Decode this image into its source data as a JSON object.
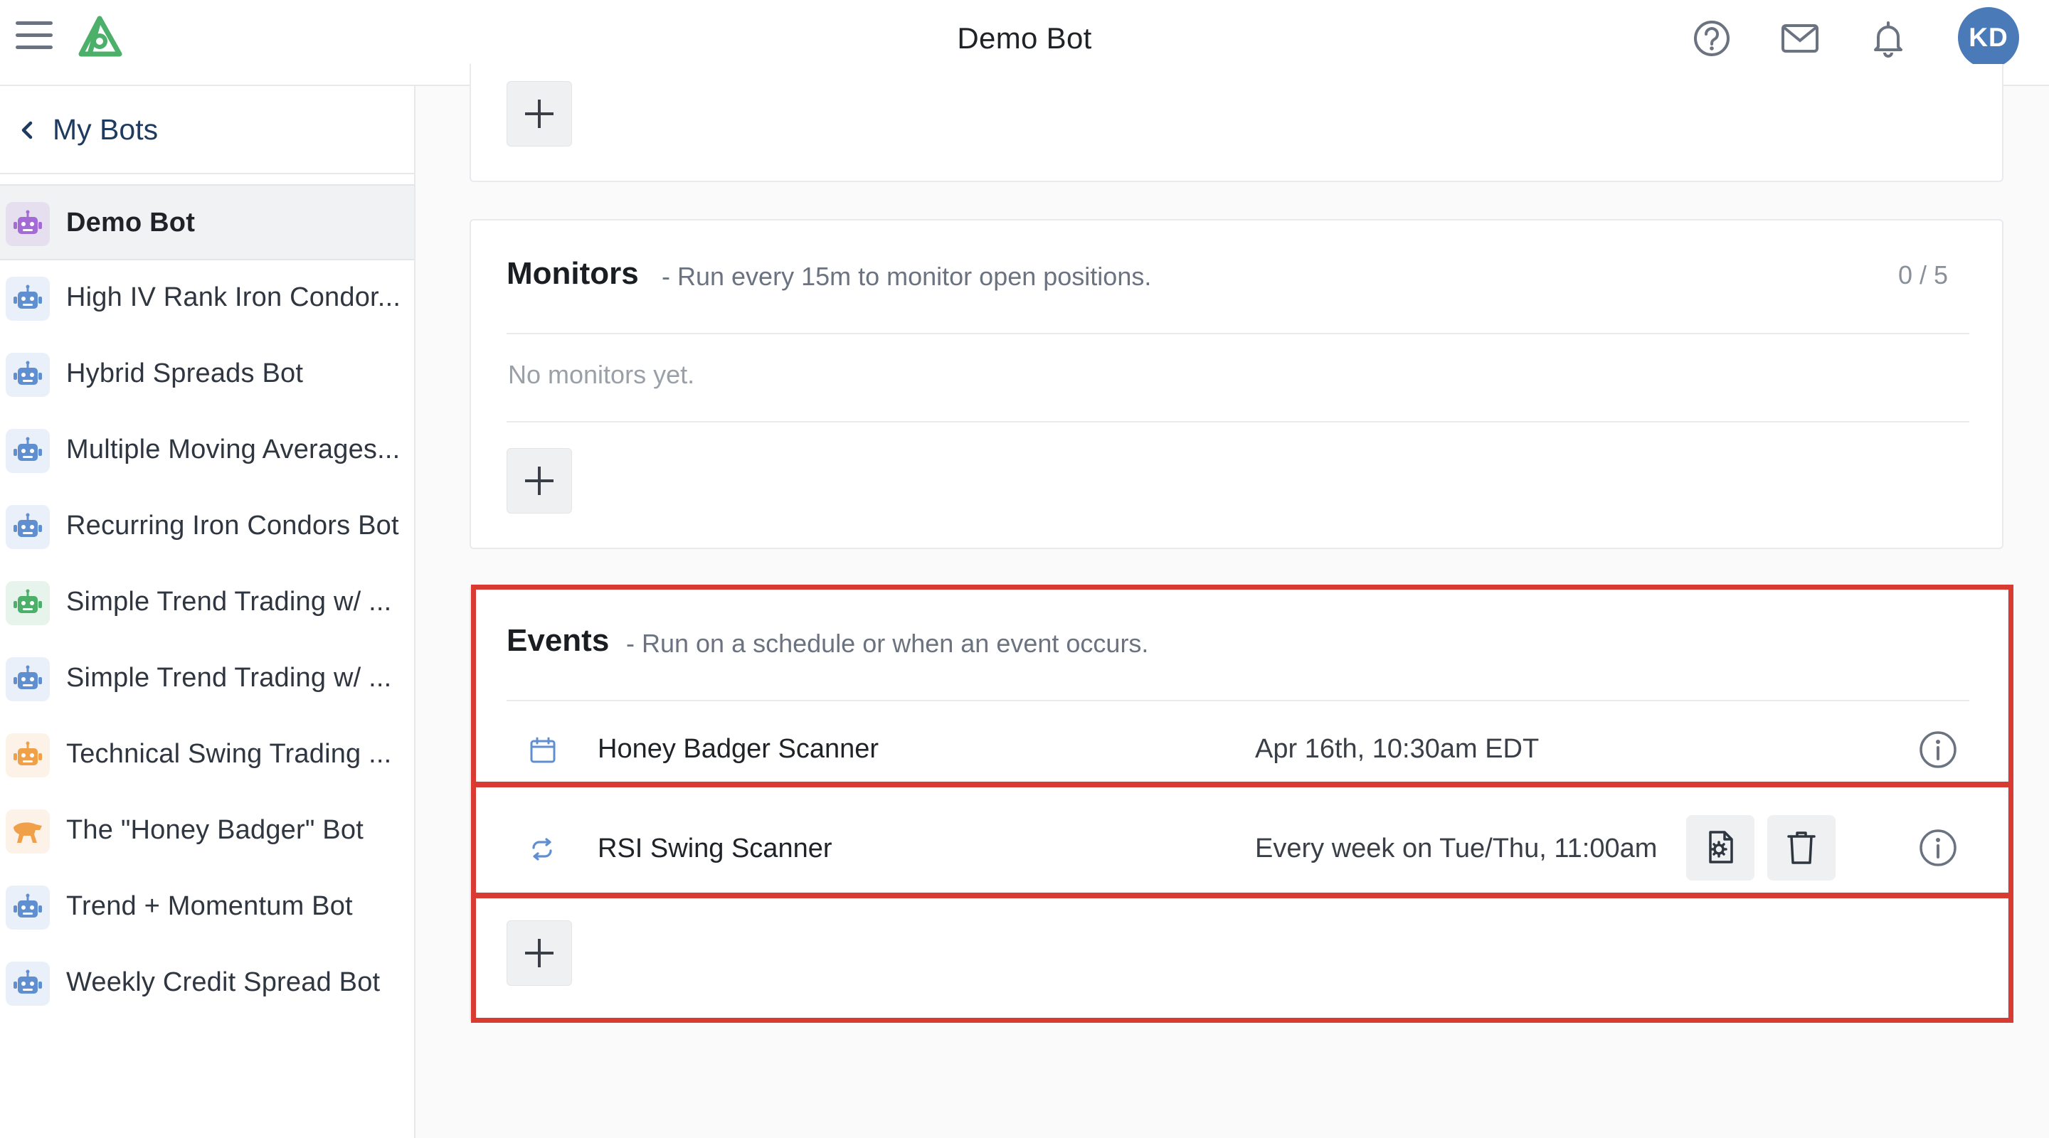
{
  "header": {
    "title": "Demo Bot",
    "avatar_initials": "KD",
    "accent_color": "#4a7ab8"
  },
  "sidebar": {
    "back_label": "My Bots",
    "items": [
      {
        "label": "Demo Bot",
        "icon": "robot-icon",
        "color": "#a46bd6",
        "active": true
      },
      {
        "label": "High IV Rank Iron Condor...",
        "icon": "robot-icon",
        "color": "#5f8fd0"
      },
      {
        "label": "Hybrid Spreads Bot",
        "icon": "robot-icon",
        "color": "#5f8fd0"
      },
      {
        "label": "Multiple Moving Averages...",
        "icon": "robot-icon",
        "color": "#5f8fd0"
      },
      {
        "label": "Recurring Iron Condors Bot",
        "icon": "robot-icon",
        "color": "#5f8fd0"
      },
      {
        "label": "Simple Trend Trading w/ ...",
        "icon": "robot-icon",
        "color": "#4caf6a"
      },
      {
        "label": "Simple Trend Trading w/ ...",
        "icon": "robot-icon",
        "color": "#5f8fd0"
      },
      {
        "label": "Technical Swing Trading ...",
        "icon": "robot-icon",
        "color": "#f0a048"
      },
      {
        "label": "The \"Honey Badger\" Bot",
        "icon": "badger-icon",
        "color": "#f0a048"
      },
      {
        "label": "Trend + Momentum Bot",
        "icon": "robot-icon",
        "color": "#5f8fd0"
      },
      {
        "label": "Weekly Credit Spread Bot",
        "icon": "robot-icon",
        "color": "#5f8fd0"
      }
    ]
  },
  "monitors": {
    "title": "Monitors",
    "subtitle": "- Run every 15m to monitor open positions.",
    "count": "0 / 5",
    "empty_text": "No monitors yet."
  },
  "events": {
    "title": "Events",
    "subtitle": "- Run on a schedule or when an event occurs.",
    "rows": [
      {
        "name": "Honey Badger Scanner",
        "schedule": "Apr 16th, 10:30am EDT",
        "icon": "calendar-icon"
      },
      {
        "name": "RSI Swing Scanner",
        "schedule": "Every week on Tue/Thu, 11:00am",
        "icon": "repeat-icon"
      }
    ]
  },
  "highlight_color": "#d93a31"
}
